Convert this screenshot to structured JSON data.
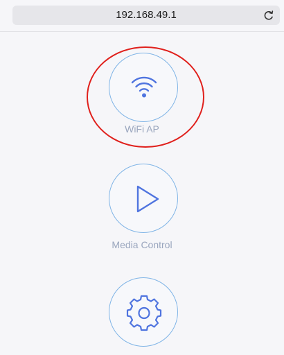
{
  "browser": {
    "url": "192.168.49.1"
  },
  "menu": {
    "items": [
      {
        "label": "WiFi AP",
        "icon": "wifi-icon"
      },
      {
        "label": "Media Control",
        "icon": "play-icon"
      },
      {
        "label": "",
        "icon": "gear-icon"
      }
    ]
  },
  "colors": {
    "highlight": "#e0201c",
    "icon_accent": "#4f74df",
    "ring": "#7fb4e6",
    "label": "#9aa6be"
  }
}
